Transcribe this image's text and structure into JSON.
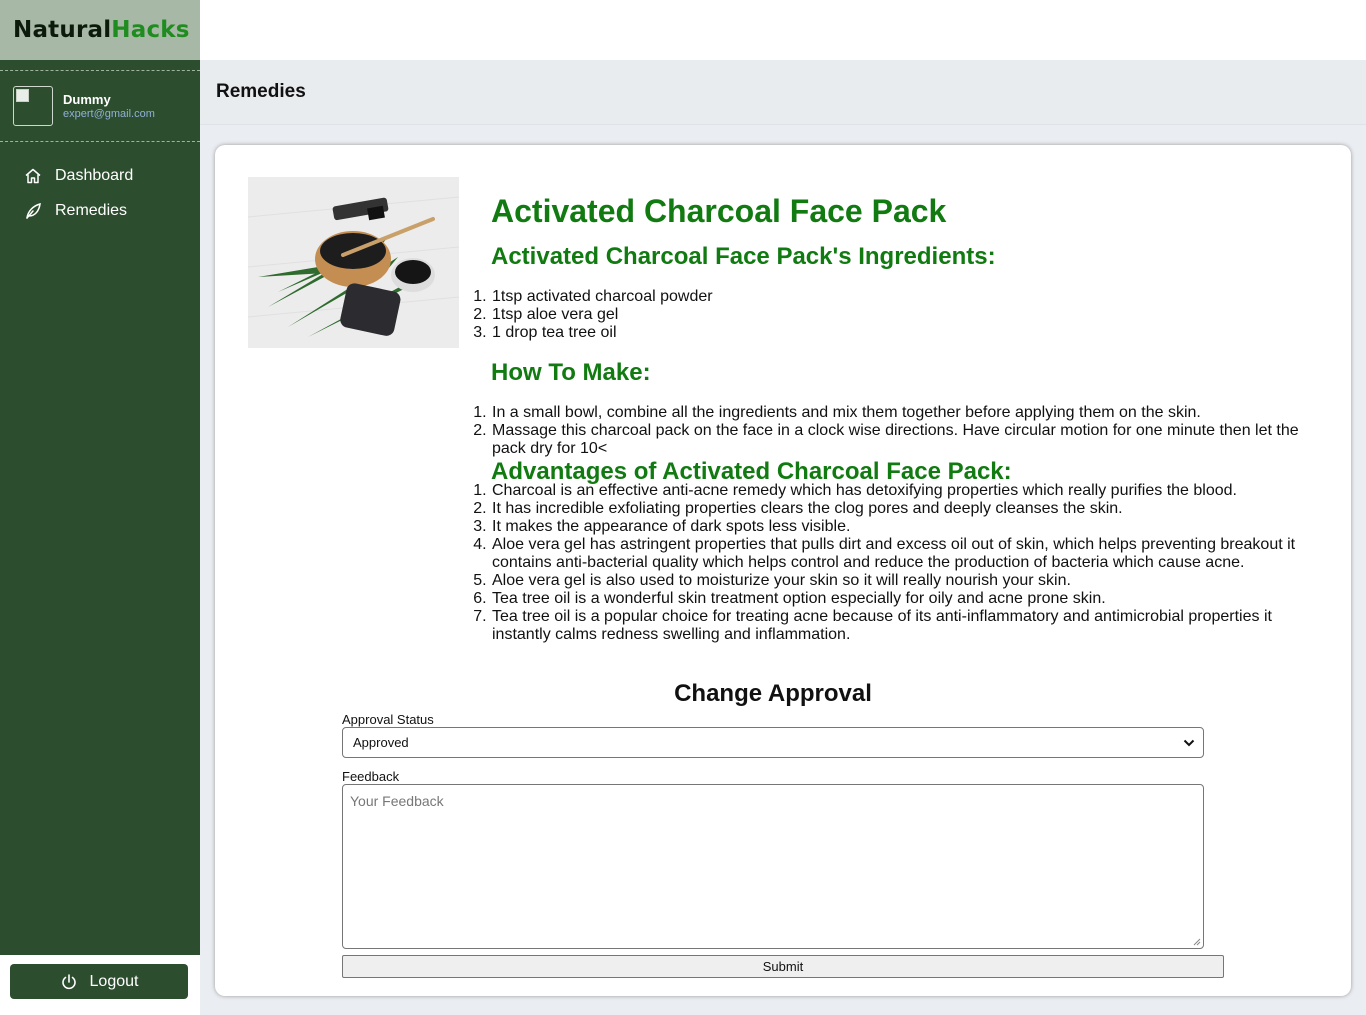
{
  "brand": {
    "part1": "Natural",
    "part2": "Hacks"
  },
  "profile": {
    "name": "Dummy",
    "email": "expert@gmail.com"
  },
  "nav": [
    {
      "label": "Dashboard",
      "icon": "home-icon"
    },
    {
      "label": "Remedies",
      "icon": "leaf-icon"
    }
  ],
  "logout_label": "Logout",
  "page_title": "Remedies",
  "remedy": {
    "title": "Activated Charcoal Face Pack",
    "ingredients_heading": "Activated Charcoal Face Pack's Ingredients:",
    "ingredients": [
      "1tsp activated charcoal powder",
      "1tsp aloe vera gel",
      "1 drop tea tree oil"
    ],
    "how_heading": "How To Make:",
    "steps": [
      "In a small bowl, combine all the ingredients and mix them together before applying them on the skin.",
      "Massage this charcoal pack on the face in a clock wise directions. Have circular motion for one minute then let the pack dry for 10<"
    ],
    "advantages_heading": "Advantages of Activated Charcoal Face Pack:",
    "advantages": [
      "Charcoal is an effective anti-acne remedy which has detoxifying properties which really purifies the blood.",
      " It has incredible exfoliating properties clears the clog pores and deeply cleanses the skin.",
      " It makes the appearance of dark spots less visible.",
      "Aloe vera gel has astringent properties that pulls dirt and excess oil out of skin, which helps preventing breakout it contains anti-bacterial quality which helps control and reduce the production of bacteria which cause acne.",
      " Aloe vera gel is also used to moisturize your skin so it will really nourish your skin.",
      "Tea tree oil is a wonderful skin treatment option especially for oily and acne prone skin.",
      "Tea tree oil is a popular choice for treating acne because of its anti-inflammatory and antimicrobial properties it instantly calms redness swelling and inflammation."
    ]
  },
  "approval": {
    "heading": "Change Approval",
    "status_label": "Approval Status",
    "status_value": "Approved",
    "feedback_label": "Feedback",
    "feedback_placeholder": "Your Feedback",
    "submit_label": "Submit"
  },
  "colors": {
    "sidebar": "#2d4d2f",
    "brand_bg": "#a8b8a6",
    "heading_green": "#117a11",
    "brand_accent": "#1f8c1f"
  }
}
